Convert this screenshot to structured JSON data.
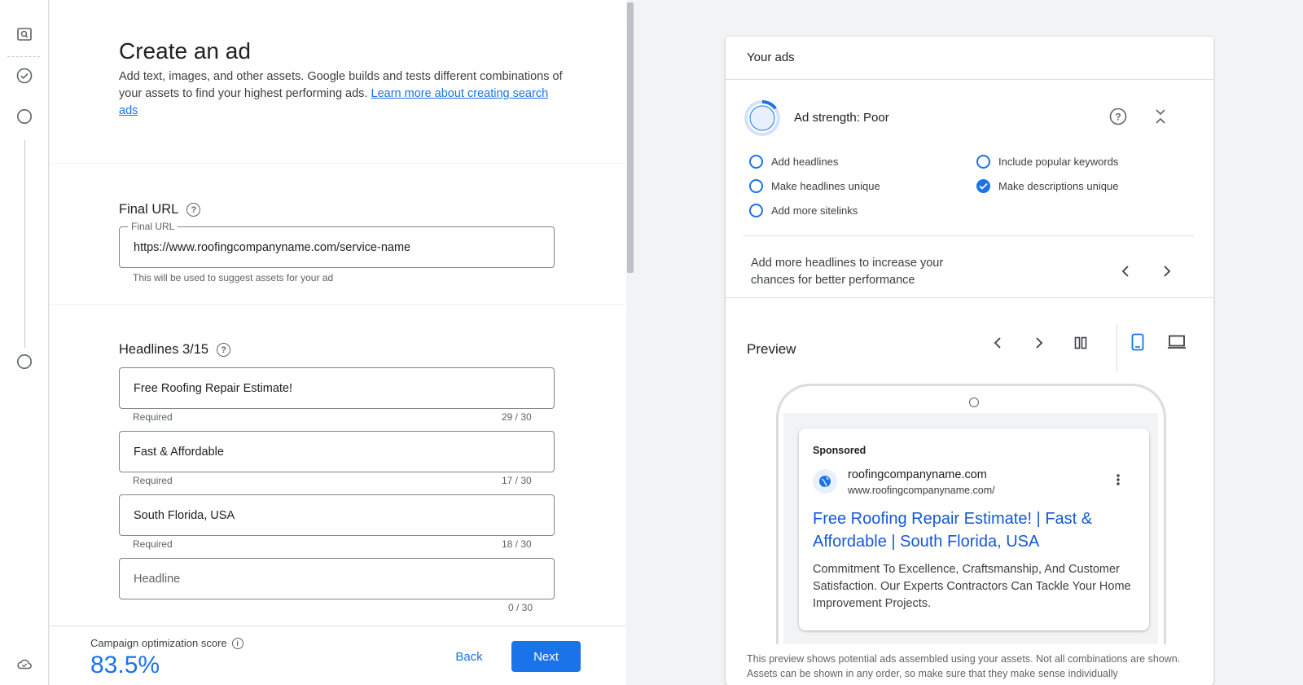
{
  "left": {
    "title": "Create an ad",
    "intro_text": "Add text, images, and other assets. Google builds and tests different combinations of your assets to find your highest performing ads.",
    "intro_link": "Learn more about creating search ads",
    "final_url": {
      "section_title": "Final URL",
      "floating_label": "Final URL",
      "value": "https://www.roofingcompanyname.com/service-name",
      "hint": "This will be used to suggest assets for your ad"
    },
    "headlines": {
      "section_title": "Headlines 3/15",
      "items": [
        {
          "value": "Free Roofing Repair Estimate!",
          "status": "Required",
          "count": "29 / 30"
        },
        {
          "value": "Fast & Affordable",
          "status": "Required",
          "count": "17 / 30"
        },
        {
          "value": "South Florida, USA",
          "status": "Required",
          "count": "18 / 30"
        }
      ],
      "empty_placeholder": "Headline",
      "empty_count": "0 / 30"
    },
    "bottom": {
      "optimization_label": "Campaign optimization score",
      "optimization_score": "83.5%",
      "back_label": "Back",
      "next_label": "Next"
    }
  },
  "right": {
    "header": "Your ads",
    "strength_label": "Ad strength: Poor",
    "strength_level": 0.15,
    "tips": [
      {
        "label": "Add headlines",
        "done": false
      },
      {
        "label": "Include popular keywords",
        "done": false
      },
      {
        "label": "Make headlines unique",
        "done": false
      },
      {
        "label": "Make descriptions unique",
        "done": true
      },
      {
        "label": "Add more sitelinks",
        "done": false
      }
    ],
    "suggestion": "Add more headlines to increase your chances for better performance",
    "preview_title": "Preview",
    "ad": {
      "sponsored": "Sponsored",
      "domain": "roofingcompanyname.com",
      "display_url": "www.roofingcompanyname.com/",
      "headline": "Free Roofing Repair Estimate! | Fast & Affordable | South Florida, USA",
      "description": "Commitment To Excellence, Craftsmanship, And Customer Satisfaction. Our Experts Contractors Can Tackle Your Home Improvement Projects."
    },
    "disclaimer": "This preview shows potential ads assembled using your assets. Not all combinations are shown. Assets can be shown in any order, so make sure that they make sense individually"
  },
  "icons": {
    "rail": [
      "preview-search-icon",
      "check-circle-icon",
      "step-circle-icon",
      "step-circle-icon",
      "cloud-icon"
    ],
    "accent": "#1a73e8"
  }
}
